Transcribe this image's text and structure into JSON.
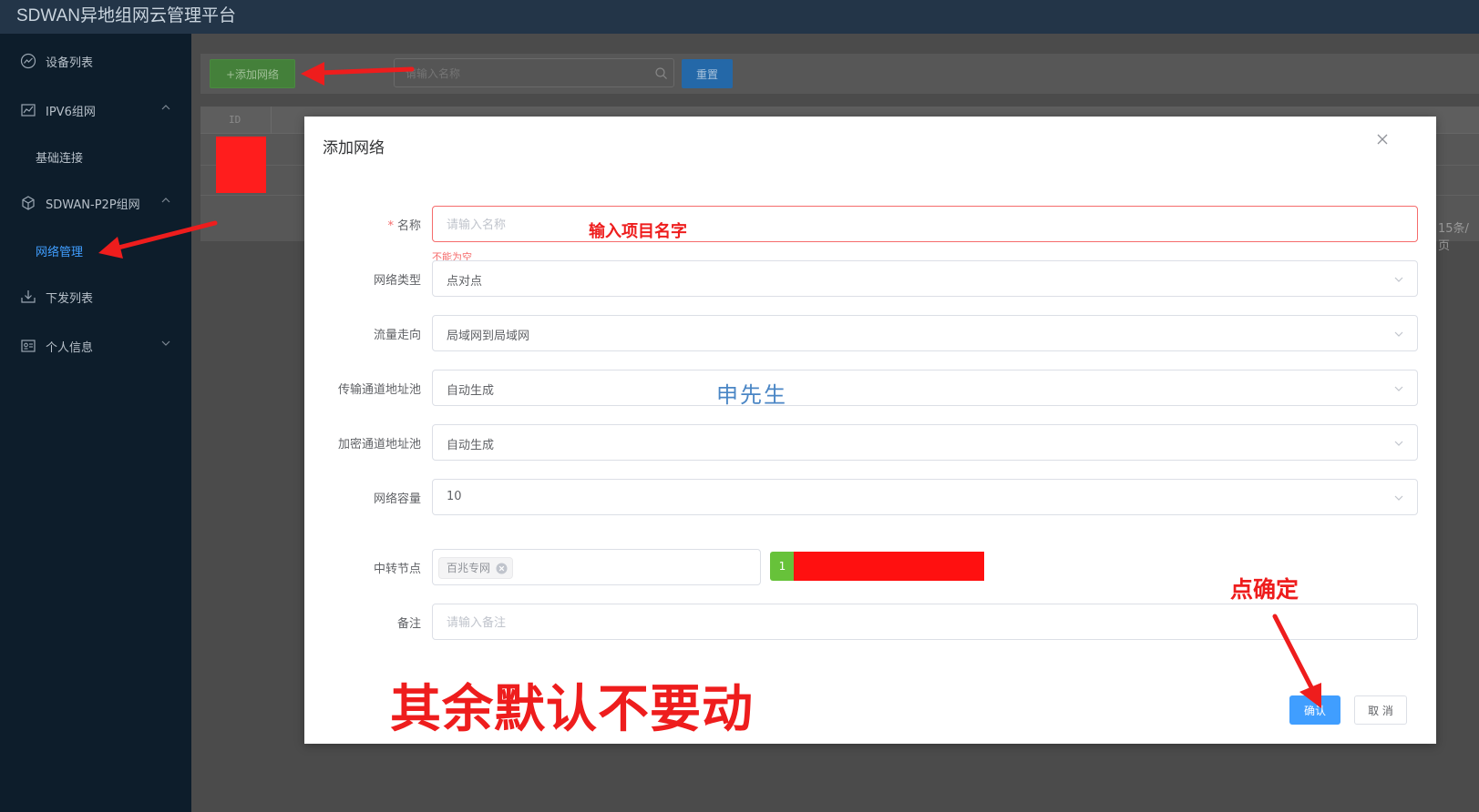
{
  "app": {
    "title": "SDWAN异地组网云管理平台"
  },
  "sidebar": {
    "items": [
      {
        "label": "设备列表",
        "icon": "chart-line-icon"
      },
      {
        "label": "IPV6组网",
        "icon": "chart-area-icon",
        "expanded": true
      },
      {
        "label": "基础连接",
        "sub": true
      },
      {
        "label": "SDWAN-P2P组网",
        "icon": "network-cube-icon",
        "expanded": true
      },
      {
        "label": "网络管理",
        "sub": true,
        "active": true
      },
      {
        "label": "下发列表",
        "icon": "download-icon"
      },
      {
        "label": "个人信息",
        "icon": "id-card-icon",
        "expanded": false
      }
    ]
  },
  "toolbar": {
    "add_label": "+添加网络",
    "search_placeholder": "请输入名称",
    "reset_label": "重置"
  },
  "table": {
    "columns": [
      "ID"
    ],
    "page_size_text": "15条/页"
  },
  "modal": {
    "title": "添加网络",
    "fields": {
      "name": {
        "label": "名称",
        "required": true,
        "placeholder": "请输入名称",
        "error": "不能为空"
      },
      "network_type": {
        "label": "网络类型",
        "value": "点对点"
      },
      "traffic_direction": {
        "label": "流量走向",
        "value": "局域网到局域网"
      },
      "transport_pool": {
        "label": "传输通道地址池",
        "value": "自动生成"
      },
      "encrypted_pool": {
        "label": "加密通道地址池",
        "value": "自动生成"
      },
      "capacity": {
        "label": "网络容量",
        "value": "10"
      },
      "relay": {
        "label": "中转节点",
        "tag": "百兆专网",
        "count": "1"
      },
      "remark": {
        "label": "备注",
        "placeholder": "请输入备注"
      }
    },
    "confirm_label": "确认",
    "cancel_label": "取 消"
  },
  "annotations": {
    "name_hint": "输入项目名字",
    "watermark": "申先生",
    "click_confirm": "点确定",
    "keep_defaults": "其余默认不要动"
  },
  "colors": {
    "topbar": "#233548",
    "sidebar": "#0d1d2b",
    "primary": "#409eff",
    "success": "#67c23a",
    "danger": "#f56c6c",
    "annotation_red": "#ee1d1d"
  }
}
